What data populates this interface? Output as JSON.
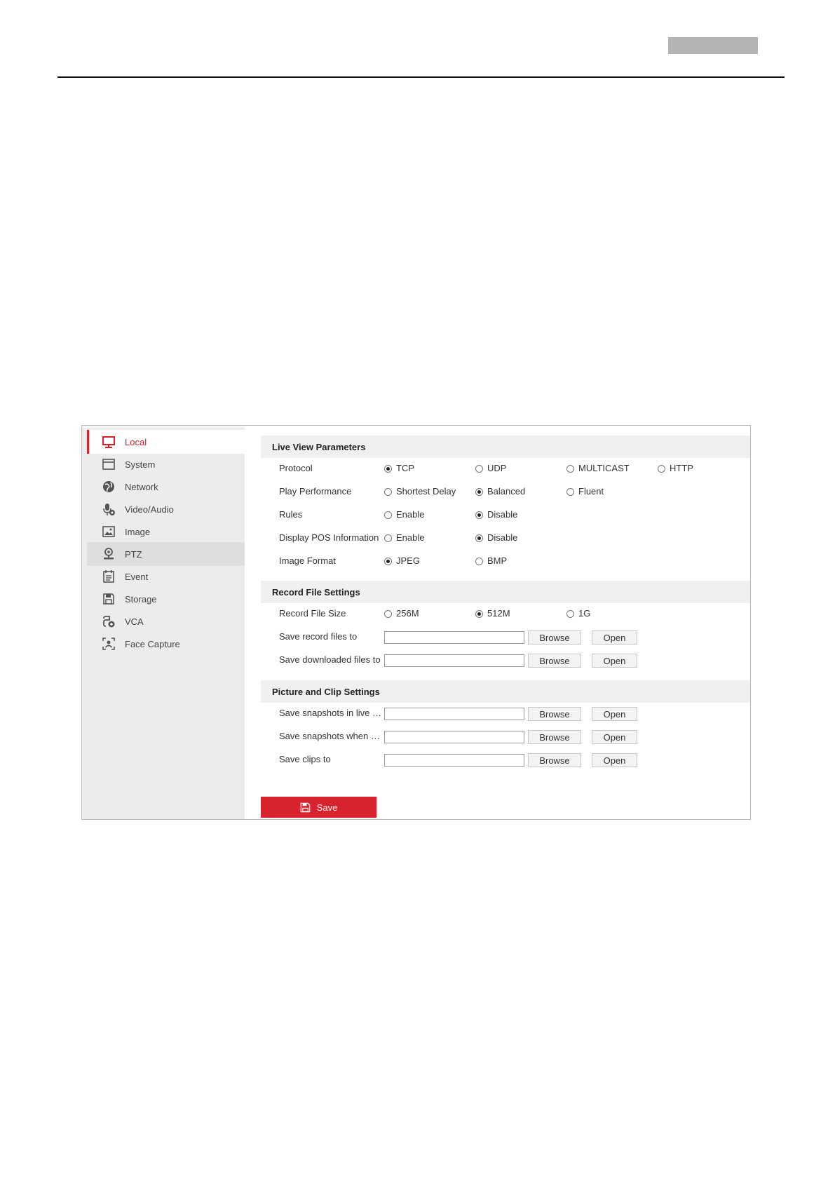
{
  "sidebar": {
    "items": [
      {
        "label": "Local",
        "icon": "monitor-icon"
      },
      {
        "label": "System",
        "icon": "window-icon"
      },
      {
        "label": "Network",
        "icon": "globe-icon"
      },
      {
        "label": "Video/Audio",
        "icon": "microphone-icon"
      },
      {
        "label": "Image",
        "icon": "image-icon"
      },
      {
        "label": "PTZ",
        "icon": "ptz-camera-icon"
      },
      {
        "label": "Event",
        "icon": "calendar-icon"
      },
      {
        "label": "Storage",
        "icon": "floppy-icon"
      },
      {
        "label": "VCA",
        "icon": "vca-icon"
      },
      {
        "label": "Face Capture",
        "icon": "face-capture-icon"
      }
    ],
    "active": "Local",
    "hovered": "PTZ"
  },
  "live_view": {
    "title": "Live View Parameters",
    "protocol": {
      "label": "Protocol",
      "options": [
        "TCP",
        "UDP",
        "MULTICAST",
        "HTTP"
      ],
      "selected": "TCP"
    },
    "play_performance": {
      "label": "Play Performance",
      "options": [
        "Shortest Delay",
        "Balanced",
        "Fluent"
      ],
      "selected": "Balanced"
    },
    "rules": {
      "label": "Rules",
      "options": [
        "Enable",
        "Disable"
      ],
      "selected": "Disable"
    },
    "display_pos": {
      "label": "Display POS Information",
      "options": [
        "Enable",
        "Disable"
      ],
      "selected": "Disable"
    },
    "image_format": {
      "label": "Image Format",
      "options": [
        "JPEG",
        "BMP"
      ],
      "selected": "JPEG"
    }
  },
  "record_file": {
    "title": "Record File Settings",
    "file_size": {
      "label": "Record File Size",
      "options": [
        "256M",
        "512M",
        "1G"
      ],
      "selected": "512M"
    },
    "save_record": {
      "label": "Save record files to",
      "value": ""
    },
    "save_downloaded": {
      "label": "Save downloaded files to",
      "value": ""
    }
  },
  "picture_clip": {
    "title": "Picture and Clip Settings",
    "save_snapshots_live": {
      "label": "Save snapshots in live vi…",
      "value": ""
    },
    "save_snapshots_playback": {
      "label": "Save snapshots when pla…",
      "value": ""
    },
    "save_clips": {
      "label": "Save clips to",
      "value": ""
    }
  },
  "buttons": {
    "browse": "Browse",
    "open": "Open",
    "save": "Save"
  },
  "colors": {
    "accent": "#d8222d",
    "sidebar_bg": "#ececec",
    "section_bg": "#f0f0f0"
  }
}
